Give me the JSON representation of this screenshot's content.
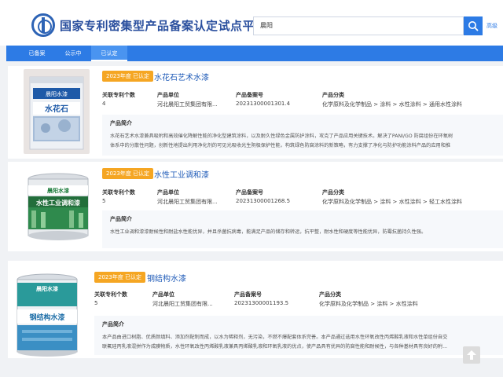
{
  "header": {
    "title": "国家专利密集型产品备案认定试点平台",
    "search_value": "晨阳",
    "advanced_label": "高级"
  },
  "nav": {
    "tabs": [
      {
        "label": "已备案"
      },
      {
        "label": "公示中"
      },
      {
        "label": "已认定"
      }
    ],
    "active_index": 2
  },
  "field_labels": {
    "patents": "关联专利个数",
    "unit": "产品单位",
    "record_no": "产品备案号",
    "category": "产品分类",
    "intro": "产品简介"
  },
  "products": [
    {
      "badge": "2023年度 已认定",
      "name": "水花石艺术水漆",
      "image_label": "水花石",
      "brand": "晨阳水漆",
      "patents": "4",
      "unit": "河北晨阳工贸集团有限...",
      "record_no": "20231300001301.4",
      "category": "化学原料及化学制品 > 涂料 > 水性涂料 > 通用水性涂料",
      "intro": [
        "水花石艺术水漆兼具吸附和高效催化降解性能的净化型建筑涂料，以及耐久性绿色金属防护涂料，攻克了产品应用关键技术。解决了PANI/GO 防腐组份在环氧树",
        "体系中的分散性问题，创新性地提出利用净化剂的可见光吸收光生阴极保护性能，构筑绿色防腐涂料的新策略，有力支撑了净化与防护功能涂料产品的应用和推"
      ]
    },
    {
      "badge": "2023年度 已认定",
      "name": "水性工业调和漆",
      "image_label": "水性工业调和漆",
      "brand": "晨阳水漆",
      "patents": "5",
      "unit": "河北晨阳工贸集团有限...",
      "record_no": "20231300001268.5",
      "category": "化学原料及化学制品 > 涂料 > 水性涂料 > 轻工水性涂料",
      "intro": [
        "水性工业调和漆漆耐候性和耐盐水性能优异，并且杀菌抗病毒，能满足产品的储存和转运，抗平整，耐水性和硬度等性能优异，防霉抗菌持久性强。"
      ]
    },
    {
      "badge": "2023年度 已认定",
      "name": "钢结构水漆",
      "image_label": "钢结构水漆",
      "brand": "晨阳水漆",
      "patents": "5",
      "unit": "河北晨阳工贸集团有限...",
      "record_no": "20231300001193.5",
      "category": "化学原料及化学制品 > 涂料 > 水性涂料",
      "intro": [
        "本产品由进口树脂、优质颜填料、添加剂配制而成，以水为稀释剂，无污染，不燃不爆配套体系完善。本产品通过选用水性环氧改性丙烯酸乳液和水性单组份自交",
        "联氟硅丙乳液混拼作为成膜物质，水性环氧改性丙烯酸乳液兼具丙烯酸乳液和环氧乳液的优点，使产品具有优异的防腐性能和耐候性，与各种基材具有良好的附..."
      ]
    }
  ],
  "colors": {
    "primary": "#2d7be5",
    "title": "#2a4f9e",
    "badge": "#f5a623",
    "product_name": "#1f5bb8"
  },
  "icons": {
    "logo": "patent-logo-icon",
    "search": "search-icon",
    "scroll_top": "arrow-up-icon"
  }
}
